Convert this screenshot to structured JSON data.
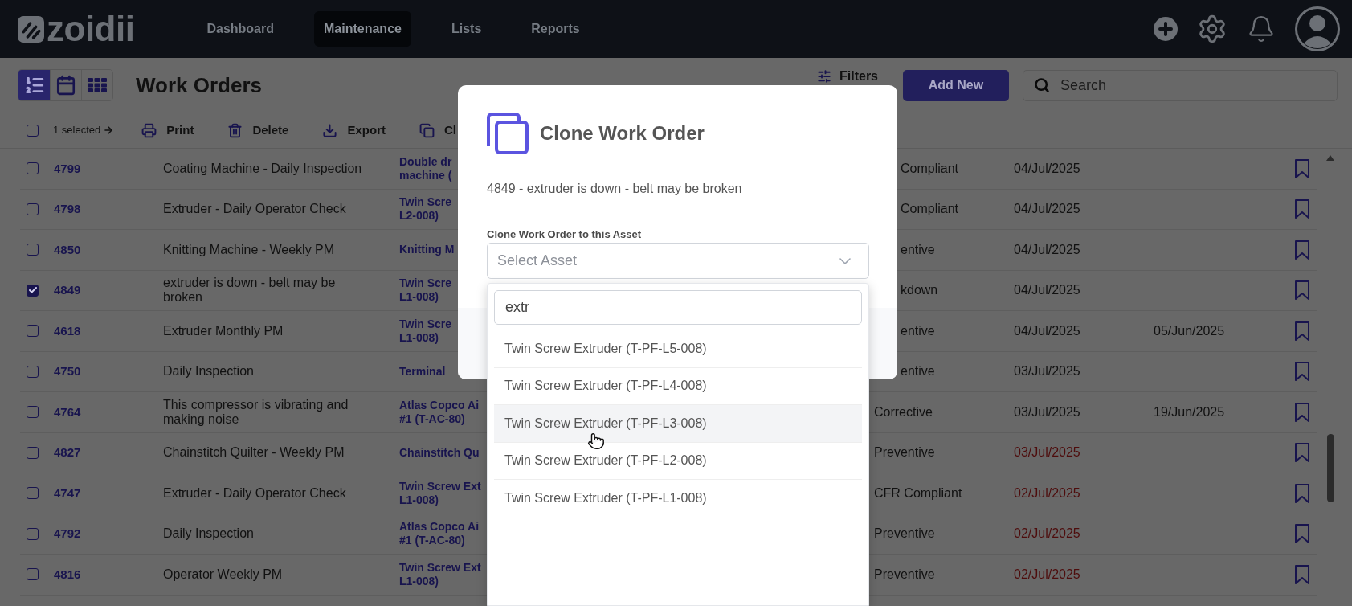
{
  "header": {
    "logo": "zoidii",
    "nav": [
      {
        "label": "Dashboard",
        "selected": false
      },
      {
        "label": "Maintenance",
        "selected": true
      },
      {
        "label": "Lists",
        "selected": false
      },
      {
        "label": "Reports",
        "selected": false
      }
    ]
  },
  "toolbar": {
    "views": [
      {
        "kind": "list",
        "selected": true
      },
      {
        "kind": "calendar",
        "selected": false
      },
      {
        "kind": "grid",
        "selected": false
      }
    ],
    "title": "Work Orders",
    "filters": "Filters",
    "add_button": "Add New",
    "search": {
      "placeholder": "Search"
    }
  },
  "actions": {
    "select_all": {
      "checked": false
    },
    "selection": "1 selected",
    "buttons": [
      {
        "kind": "print",
        "label": "Print"
      },
      {
        "kind": "delete",
        "label": "Delete"
      },
      {
        "kind": "export",
        "label": "Export"
      },
      {
        "kind": "clone",
        "label": "Cl"
      }
    ]
  },
  "table": {
    "rows": [
      {
        "number": "4799",
        "description": "Coating Machine - Daily Inspection",
        "asset": "Double dr\nmachine (",
        "type": "Compliant",
        "date": "04/Jul/2025",
        "checked": false,
        "overdue": false
      },
      {
        "number": "4798",
        "description": "Extruder - Daily Operator Check",
        "asset": "Twin Scre\nL2-008)",
        "type": "Compliant",
        "date": "04/Jul/2025",
        "checked": false,
        "overdue": false
      },
      {
        "number": "4850",
        "description": "Knitting Machine - Weekly PM",
        "asset": "Knitting M",
        "type": "entive",
        "date": "04/Jul/2025",
        "checked": false,
        "overdue": false
      },
      {
        "number": "4849",
        "description": "extruder is down - belt may be broken",
        "asset": "Twin Scre\nL1-008)",
        "type": "kdown",
        "date": "04/Jul/2025",
        "checked": true,
        "overdue": false
      },
      {
        "number": "4618",
        "description": "Extruder Monthly PM",
        "asset": "Twin Scre\nL1-008)",
        "type": "entive",
        "date": "04/Jul/2025",
        "date_2": "05/Jun/2025",
        "checked": false,
        "overdue": false
      },
      {
        "number": "4750",
        "description": "Daily Inspection",
        "asset": "Terminal",
        "type": "entive",
        "date": "03/Jul/2025",
        "checked": false,
        "overdue": false
      },
      {
        "number": "4764",
        "description": "This compressor is vibrating and making noise",
        "asset": "Atlas Copco Ai\n#1  (T-AC-80)",
        "type": "Corrective",
        "date": "03/Jul/2025",
        "date_2": "19/Jun/2025",
        "checked": false,
        "overdue": false
      },
      {
        "number": "4827",
        "description": "Chainstitch Quilter - Weekly PM",
        "asset": "Chainstitch Qu",
        "type": "Preventive",
        "date": "03/Jul/2025",
        "checked": false,
        "overdue": true
      },
      {
        "number": "4747",
        "description": "Extruder - Daily Operator Check",
        "asset": "Twin Screw Ext\nL1-008)",
        "type": "CFR Compliant",
        "date": "02/Jul/2025",
        "checked": false,
        "overdue": true
      },
      {
        "number": "4792",
        "description": "Daily Inspection",
        "asset": "Atlas Copco Ai\n#1  (T-AC-80)",
        "type": "Preventive",
        "date": "02/Jul/2025",
        "checked": false,
        "overdue": true
      },
      {
        "number": "4816",
        "description": "Operator Weekly PM",
        "asset": "Twin Screw Ext\nL1-008)",
        "type": "Preventive",
        "date": "02/Jul/2025",
        "checked": false,
        "overdue": true
      }
    ]
  },
  "dialog": {
    "title": "Clone Work Order",
    "subtitle": "4849 - extruder is down - belt may be broken",
    "field_label": "Clone Work Order to this Asset",
    "select": {
      "placeholder": "Select Asset",
      "expanded": true
    },
    "dropdown": {
      "search_value": "extr",
      "options": [
        {
          "label": "Twin Screw Extruder (T-PF-L5-008)",
          "highlighted": false
        },
        {
          "label": "Twin Screw Extruder (T-PF-L4-008)",
          "highlighted": false
        },
        {
          "label": "Twin Screw Extruder (T-PF-L3-008)",
          "highlighted": true
        },
        {
          "label": "Twin Screw Extruder (T-PF-L2-008)",
          "highlighted": false
        },
        {
          "label": "Twin Screw Extruder (T-PF-L1-008)",
          "highlighted": false
        }
      ]
    }
  }
}
